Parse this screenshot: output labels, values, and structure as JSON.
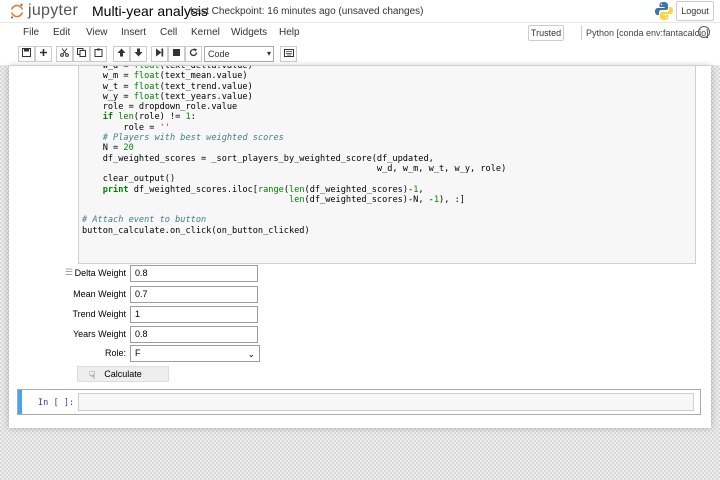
{
  "header": {
    "logo_text": "jupyter",
    "notebook_title": "Multi-year analysis",
    "checkpoint": "Last Checkpoint: 16 minutes ago (unsaved changes)",
    "logout_label": "Logout"
  },
  "menubar": {
    "items": [
      "File",
      "Edit",
      "View",
      "Insert",
      "Cell",
      "Kernel",
      "Widgets",
      "Help"
    ],
    "trusted_label": "Trusted",
    "kernel_name": "Python [conda env:fantacalcio]"
  },
  "toolbar": {
    "buttons": [
      "save-icon",
      "add-icon",
      "cut-icon",
      "copy-icon",
      "paste-icon",
      "move-up-icon",
      "move-down-icon",
      "run-icon",
      "stop-icon",
      "restart-icon",
      "keyboard-icon"
    ],
    "cell_type": "Code"
  },
  "code_lines": [
    "    w_d = float(text_delta.value)",
    "    w_m = float(text_mean.value)",
    "    w_t = float(text_trend.value)",
    "    w_y = float(text_years.value)",
    "    role = dropdown_role.value",
    "    if len(role) != 1:",
    "        role = ''",
    "    # Players with best weighted scores",
    "    N = 20",
    "    df_weighted_scores = _sort_players_by_weighted_score(df_updated,",
    "                                                         w_d, w_m, w_t, w_y, role)",
    "    clear_output()",
    "    print df_weighted_scores.iloc[range(len(df_weighted_scores)-1,",
    "                                        len(df_weighted_scores)-N, -1), :]",
    "",
    "# Attach event to button",
    "button_calculate.on_click(on_button_clicked)"
  ],
  "widgets": {
    "fields": [
      {
        "label": "Delta Weight",
        "value": "0.8"
      },
      {
        "label": "Mean Weight",
        "value": "0.7"
      },
      {
        "label": "Trend Weight",
        "value": "1"
      },
      {
        "label": "Years Weight",
        "value": "0.8"
      }
    ],
    "role_label": "Role:",
    "role_value": "F",
    "calculate_label": "Calculate"
  },
  "new_cell": {
    "prompt": "In [ ]:"
  }
}
